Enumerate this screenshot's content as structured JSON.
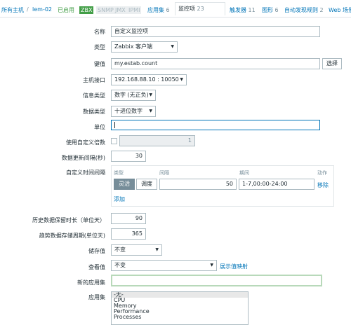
{
  "nav": {
    "all_hosts": "所有主机",
    "sep1": "/",
    "host": "lem-02",
    "enabled": "已启用",
    "zbx": "ZBX",
    "snmp": "SNMP",
    "jmx": "JMX",
    "ipmi": "IPMI",
    "applications": "应用集",
    "applications_count": "6",
    "items": "监控项",
    "items_count": "23",
    "triggers": "触发器",
    "triggers_count": "11",
    "graphs": "图形",
    "graphs_count": "6",
    "discovery": "自动发现规则",
    "discovery_count": "2",
    "web": "Web 场景"
  },
  "form": {
    "name_label": "名称",
    "name_value": "自定义监控项",
    "type_label": "类型",
    "type_value": "Zabbix 客户端",
    "key_label": "键值",
    "key_value": "my.estab.count",
    "select_button": "选择",
    "interface_label": "主机接口",
    "interface_value": "192.168.88.10 : 10050",
    "info_type_label": "信息类型",
    "info_type_value": "数字 (无正负)",
    "data_type_label": "数据类型",
    "data_type_value": "十进位数字",
    "units_label": "单位",
    "units_value": "",
    "multiplier_label": "使用自定义倍数",
    "multiplier_value": "1",
    "interval_label": "数据更新间隔(秒)",
    "interval_value": "30",
    "custom_interval_label": "自定义时间间隔",
    "col_type": "类型",
    "col_interval": "间隔",
    "col_period": "期间",
    "col_action": "动作",
    "flexible": "灵活",
    "scheduling": "调度",
    "custom_interval_value": "50",
    "period_value": "1-7,00:00-24:00",
    "remove": "移除",
    "add": "添加",
    "history_label": "历史数据保留时长（单位天）",
    "history_value": "90",
    "trends_label": "趋势数据存储周期(单位天)",
    "trends_value": "365",
    "store_label": "储存值",
    "store_value": "不变",
    "show_label": "查看值",
    "show_value": "不变",
    "show_mapping": "展示值映射",
    "new_app_label": "新的应用集",
    "new_app_value": "",
    "apps_label": "应用集",
    "apps_options": [
      "-无-",
      "CPU",
      "Memory",
      "Performance",
      "Processes"
    ]
  }
}
